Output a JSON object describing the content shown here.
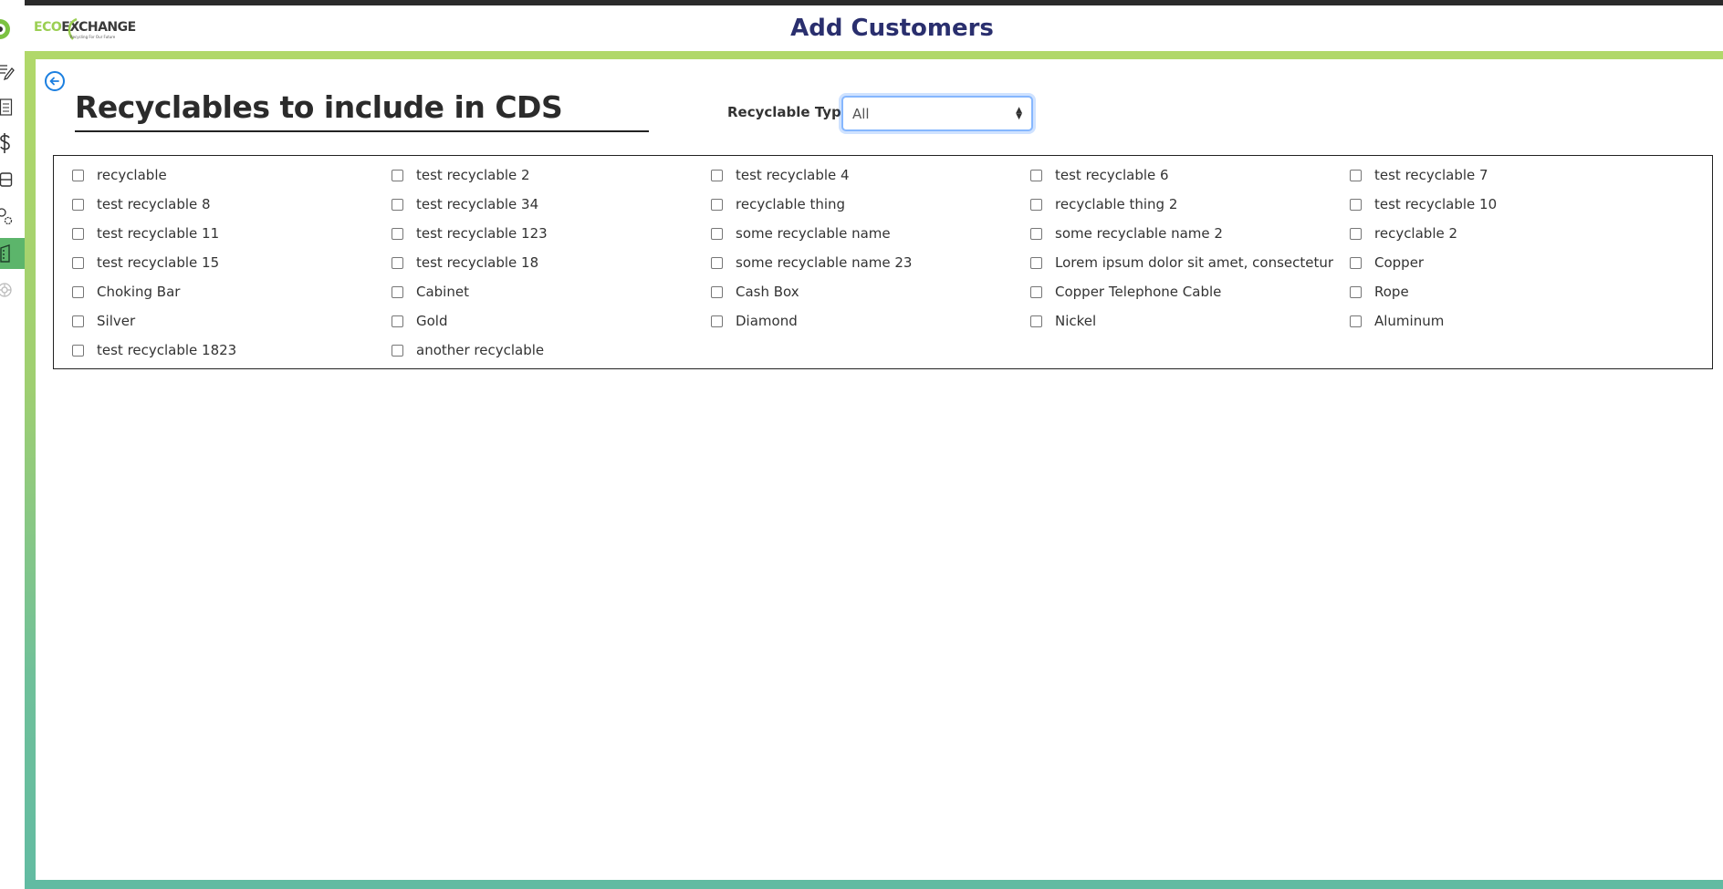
{
  "app": {
    "logo_text_eco": "ECO",
    "logo_text_exchange": "EXCHANGE",
    "logo_tagline": "Recycling For Our Future",
    "page_title": "Add Customers"
  },
  "colors": {
    "title": "#2a2f6e",
    "logo_green": "#9bcf53",
    "frame_top": "#b1d86a",
    "frame_bottom": "#62bba2",
    "sidebar_active": "#5cb56b",
    "focus_blue": "#86b7fe",
    "back_blue": "#1b7fe0"
  },
  "sidebar": {
    "icons": [
      "edit-list-icon",
      "document-list-icon",
      "dollar-icon",
      "card-icon",
      "gears-icon",
      "building-icon",
      "recycle-wheel-icon"
    ],
    "active_icon": "building-icon"
  },
  "content": {
    "back_icon": "arrow-left-circle-icon",
    "section_title": "Recyclables to include in CDS",
    "filter_label": "Recyclable Type:",
    "filter_value": "All"
  },
  "recyclables": [
    "recyclable",
    "test recyclable 2",
    "test recyclable 4",
    "test recyclable 6",
    "test recyclable 7",
    "test recyclable 8",
    "test recyclable 34",
    "recyclable thing",
    "recyclable thing 2",
    "test recyclable 10",
    "test recyclable 11",
    "test recyclable 123",
    "some recyclable name",
    "some recyclable name 2",
    "recyclable 2",
    "test recyclable 15",
    "test recyclable 18",
    "some recyclable name 23",
    "Lorem ipsum dolor sit amet, consectetur",
    "Copper",
    "Choking Bar",
    "Cabinet",
    "Cash Box",
    "Copper Telephone Cable",
    "Rope",
    "Silver",
    "Gold",
    "Diamond",
    "Nickel",
    "Aluminum",
    "test recyclable 1823",
    "another recyclable"
  ]
}
